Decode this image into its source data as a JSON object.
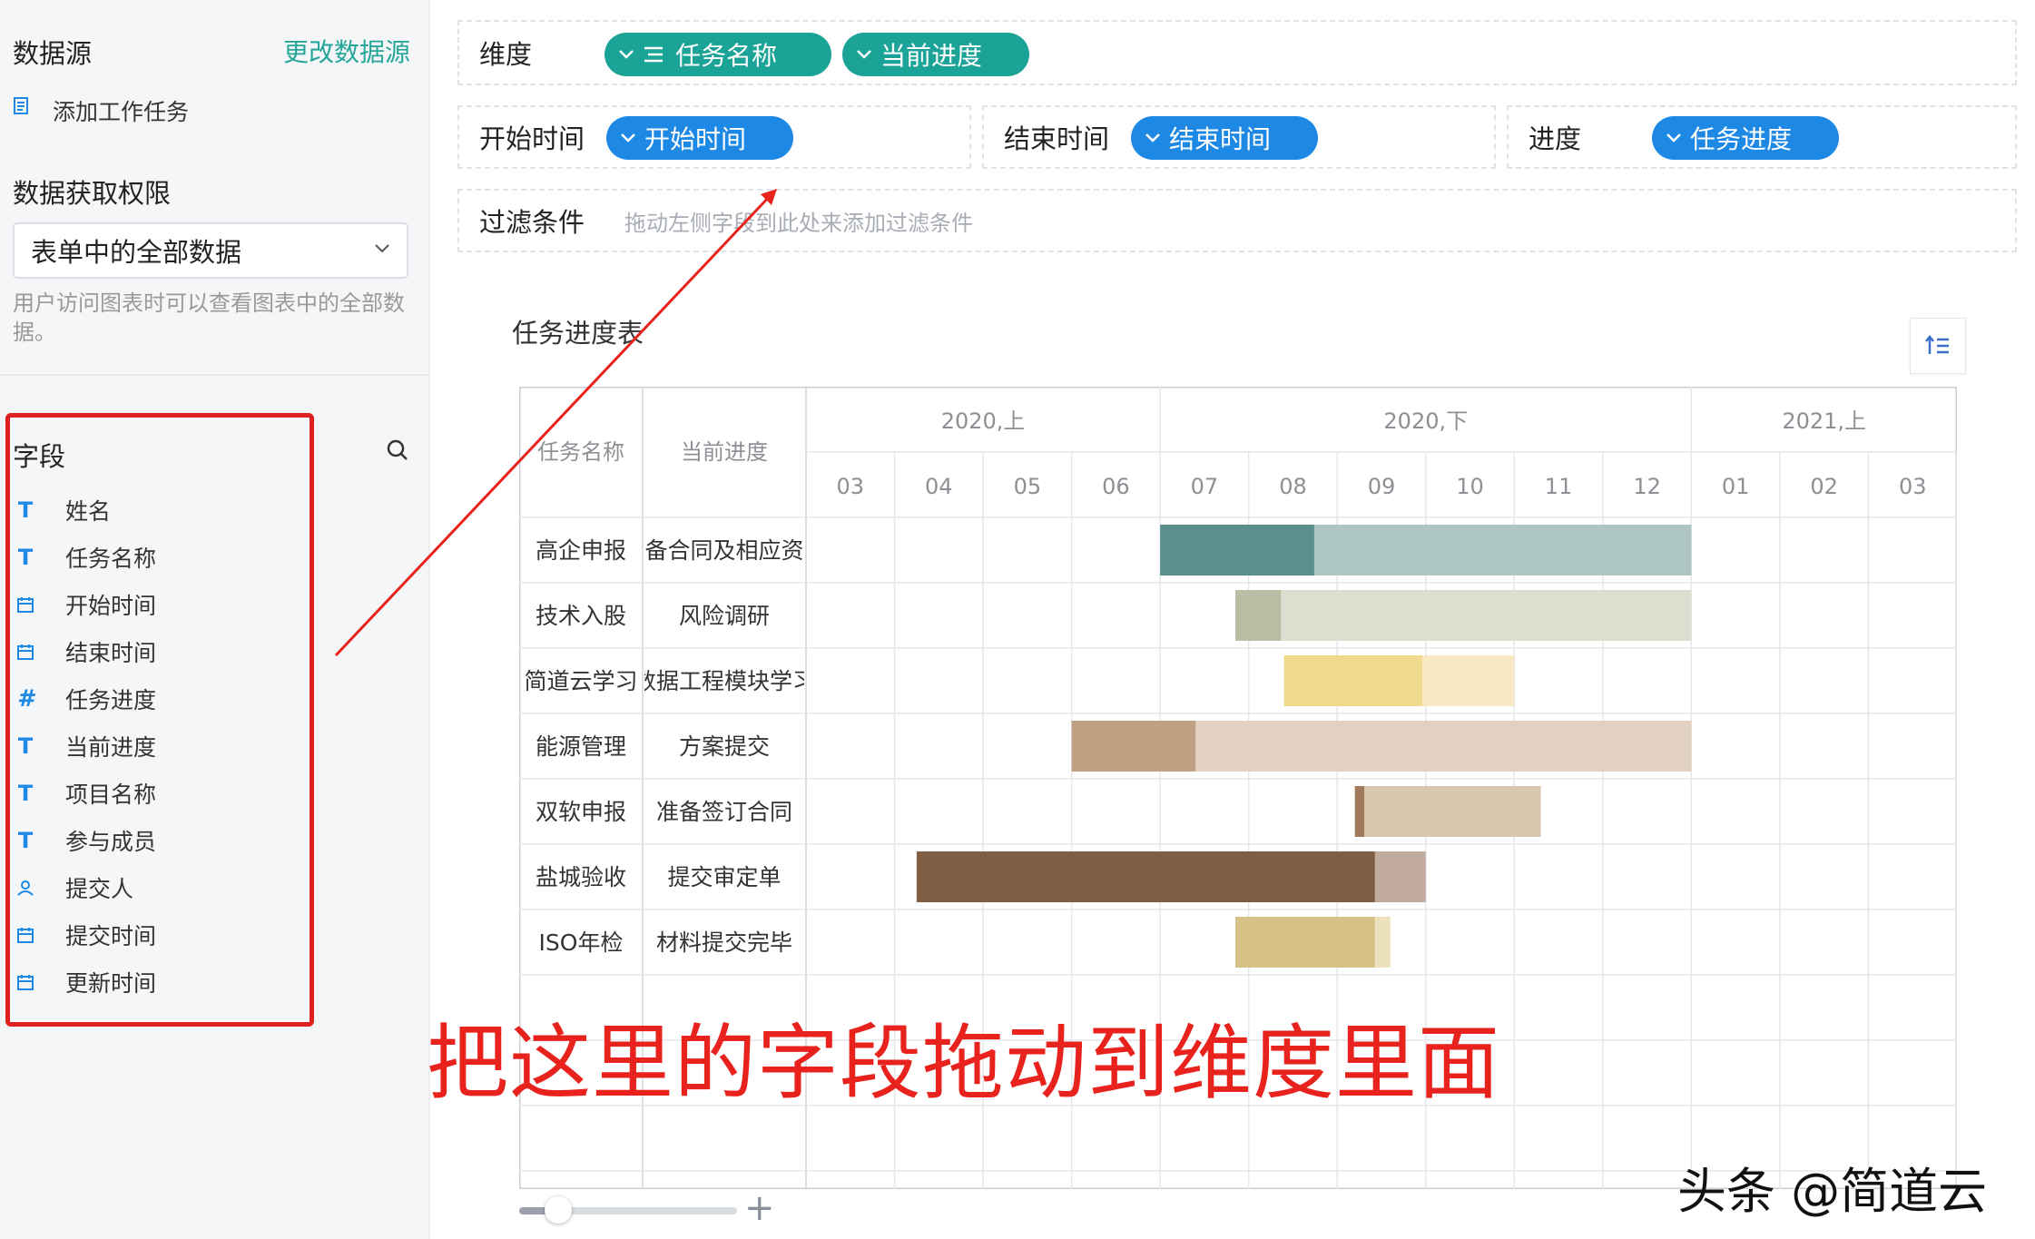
{
  "sidebar": {
    "datasource_label": "数据源",
    "change_datasource": "更改数据源",
    "datasource_item": "添加工作任务",
    "permission_label": "数据获取权限",
    "permission_value": "表单中的全部数据",
    "permission_hint": "用户访问图表时可以查看图表中的全部数据。",
    "fields_label": "字段",
    "fields": [
      {
        "label": "姓名",
        "icon": "T"
      },
      {
        "label": "任务名称",
        "icon": "T"
      },
      {
        "label": "开始时间",
        "icon": "cal"
      },
      {
        "label": "结束时间",
        "icon": "cal"
      },
      {
        "label": "任务进度",
        "icon": "#"
      },
      {
        "label": "当前进度",
        "icon": "T"
      },
      {
        "label": "项目名称",
        "icon": "T"
      },
      {
        "label": "参与成员",
        "icon": "T"
      },
      {
        "label": "提交人",
        "icon": "user"
      },
      {
        "label": "提交时间",
        "icon": "cal"
      },
      {
        "label": "更新时间",
        "icon": "cal"
      }
    ]
  },
  "config": {
    "dimension_label": "维度",
    "dimension_pills": [
      "任务名称",
      "当前进度"
    ],
    "start_label": "开始时间",
    "start_pill": "开始时间",
    "end_label": "结束时间",
    "end_pill": "结束时间",
    "progress_label": "进度",
    "progress_pill": "任务进度",
    "filter_label": "过滤条件",
    "filter_hint": "拖动左侧字段到此处来添加过滤条件"
  },
  "chart": {
    "title": "任务进度表",
    "col_task": "任务名称",
    "col_progress": "当前进度",
    "half_years": [
      "2020,上",
      "2020,下",
      "2021,上"
    ],
    "months": [
      "03",
      "04",
      "05",
      "06",
      "07",
      "08",
      "09",
      "10",
      "11",
      "12",
      "01",
      "02",
      "03"
    ]
  },
  "chart_data": {
    "type": "gantt",
    "rows": [
      {
        "task": "高企申报",
        "progress_text": "准备合同及相应资料",
        "start": 4.0,
        "end": 10.0,
        "progress": 0.29,
        "color": "#5a8f8c",
        "light": "#adc6c4"
      },
      {
        "task": "技术入股",
        "progress_text": "风险调研",
        "start": 4.85,
        "end": 10.0,
        "progress": 0.1,
        "color": "#b9bda4",
        "light": "#dcdfd0"
      },
      {
        "task": "简道云学习",
        "progress_text": "数据工程模块学习",
        "start": 5.4,
        "end": 8.0,
        "progress": 0.6,
        "color": "#f0d98a",
        "light": "#f8e9c2"
      },
      {
        "task": "能源管理",
        "progress_text": "方案提交",
        "start": 3.0,
        "end": 10.0,
        "progress": 0.2,
        "color": "#c0a083",
        "light": "#e2d0c0"
      },
      {
        "task": "双软申报",
        "progress_text": "准备签订合同",
        "start": 6.2,
        "end": 8.3,
        "progress": 0.05,
        "color": "#a07a5a",
        "light": "#d9c6ae"
      },
      {
        "task": "盐城验收",
        "progress_text": "提交审定单",
        "start": 1.25,
        "end": 7.0,
        "progress": 0.9,
        "color": "#7f5e43",
        "light": "#c0ab9c"
      },
      {
        "task": "ISO年检",
        "progress_text": "材料提交完毕",
        "start": 4.85,
        "end": 6.6,
        "progress": 0.9,
        "color": "#d6c186",
        "light": "#ede1bd"
      }
    ]
  },
  "annotation": "把这里的字段拖动到维度里面",
  "watermark": "头条 @简道云"
}
